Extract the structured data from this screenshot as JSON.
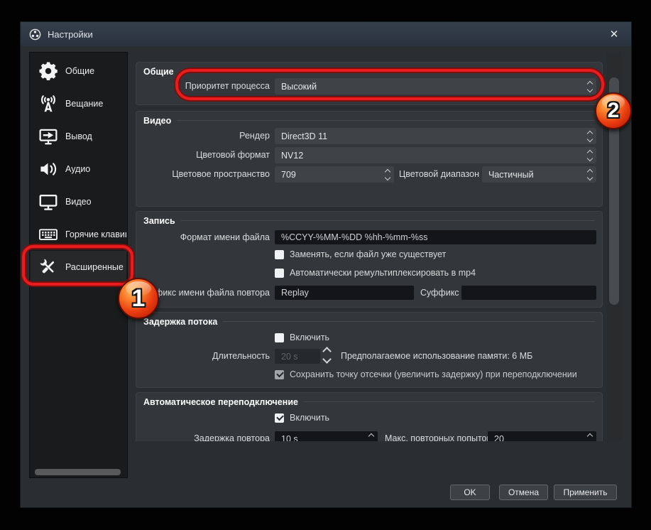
{
  "window": {
    "title": "Настройки",
    "close_glyph": "✕"
  },
  "sidebar": {
    "items": [
      {
        "label": "Общие",
        "icon": "gear-icon"
      },
      {
        "label": "Вещание",
        "icon": "broadcast-icon"
      },
      {
        "label": "Вывод",
        "icon": "output-monitor-arrow-icon"
      },
      {
        "label": "Аудио",
        "icon": "speaker-icon"
      },
      {
        "label": "Видео",
        "icon": "monitor-icon"
      },
      {
        "label": "Горячие клавиш",
        "icon": "keyboard-icon"
      },
      {
        "label": "Расширенные",
        "icon": "crossed-tools-icon"
      }
    ]
  },
  "sections": {
    "general": {
      "title": "Общие",
      "process_priority_label": "Приоритет процесса",
      "process_priority_value": "Высокий"
    },
    "video": {
      "title": "Видео",
      "renderer_label": "Рендер",
      "renderer_value": "Direct3D 11",
      "color_format_label": "Цветовой формат",
      "color_format_value": "NV12",
      "color_space_label": "Цветовое пространство",
      "color_space_value": "709",
      "color_range_label": "Цветовой диапазон",
      "color_range_value": "Частичный"
    },
    "recording": {
      "title": "Запись",
      "filename_label": "Формат имени файла",
      "filename_value": "%CCYY-%MM-%DD %hh-%mm-%ss",
      "overwrite_label": "Заменять, если файл уже существует",
      "overwrite_checked": false,
      "remux_label": "Автоматически ремультиплексировать в mp4",
      "remux_checked": false,
      "replay_prefix_label": "Префикс имени файла повтора",
      "replay_prefix_value": "Replay",
      "suffix_label": "Суффикс",
      "suffix_value": ""
    },
    "stream_delay": {
      "title": "Задержка потока",
      "enable_label": "Включить",
      "enable_checked": false,
      "duration_label": "Длительность",
      "duration_value": "20 s",
      "duration_disabled": true,
      "memory_note": "Предполагаемое использование памяти: 6 МБ",
      "preserve_label": "Сохранить точку отсечки (увеличить задержку) при переподключении",
      "preserve_checked": true,
      "preserve_disabled": true
    },
    "auto_reconnect": {
      "title": "Автоматическое переподключение",
      "enable_label": "Включить",
      "enable_checked": true,
      "retry_delay_label": "Задержка повтора",
      "retry_delay_value": "10 s",
      "max_retries_label": "Макс. повторных попыток",
      "max_retries_value": "20"
    }
  },
  "footer": {
    "ok_label": "OK",
    "cancel_label": "Отмена",
    "apply_label": "Применить"
  },
  "annotations": {
    "step1_label": "1",
    "step2_label": "2",
    "highlight_color": "#e81c1c"
  }
}
